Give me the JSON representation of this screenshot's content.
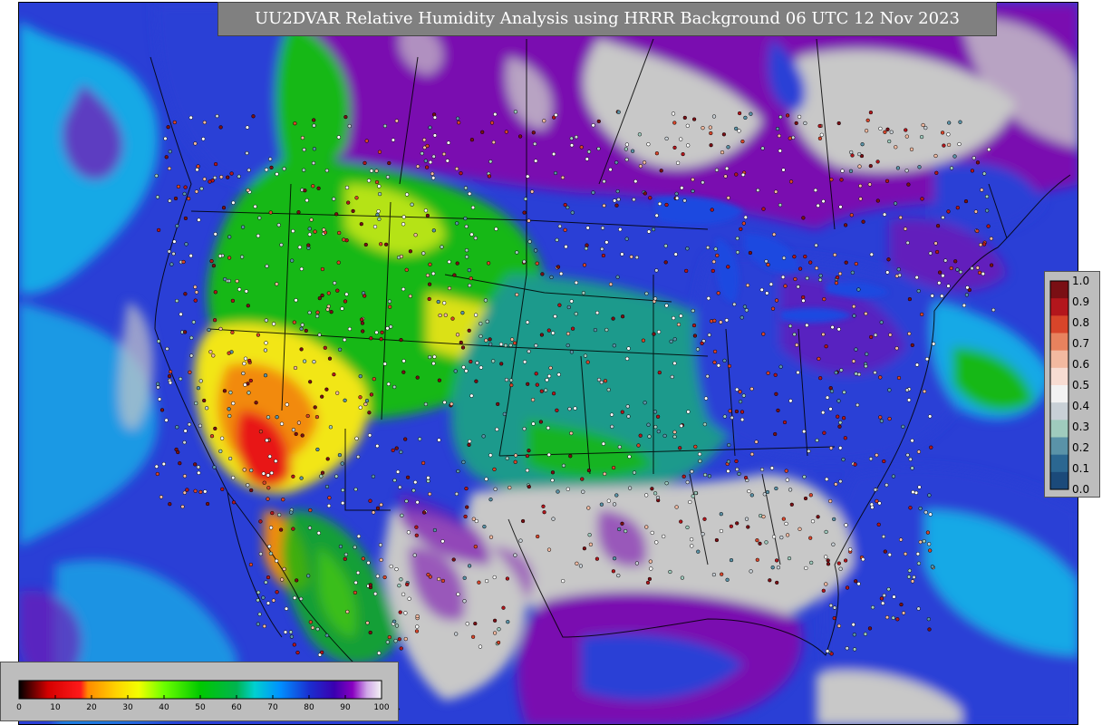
{
  "title": "UU2DVAR Relative Humidity Analysis using HRRR Background 06 UTC 12 Nov 2023",
  "colors": {
    "ocean": "#2a3fd6",
    "cloud_gray": "#c8c8c8",
    "purple": "#7a0fb0",
    "cyan": "#19a9e6",
    "green": "#12b812",
    "teal": "#1f9a8c",
    "yellow": "#f2e618",
    "orange": "#f28a0c",
    "red": "#e81818",
    "coast": "#000000"
  },
  "rh_colorbar": {
    "tick_labels": [
      "0",
      "10",
      "20",
      "30",
      "40",
      "50",
      "60",
      "70",
      "80",
      "90",
      "100"
    ],
    "stops": [
      {
        "v": 0,
        "c": "#000000"
      },
      {
        "v": 4,
        "c": "#6b0000"
      },
      {
        "v": 8,
        "c": "#d40000"
      },
      {
        "v": 17,
        "c": "#ff1a1a"
      },
      {
        "v": 19,
        "c": "#ff8a00"
      },
      {
        "v": 27,
        "c": "#ffd400"
      },
      {
        "v": 33,
        "c": "#f2ff00"
      },
      {
        "v": 40,
        "c": "#6cff00"
      },
      {
        "v": 50,
        "c": "#00c800"
      },
      {
        "v": 60,
        "c": "#00b450"
      },
      {
        "v": 65,
        "c": "#00d0d0"
      },
      {
        "v": 72,
        "c": "#0090ff"
      },
      {
        "v": 80,
        "c": "#1a2fd0"
      },
      {
        "v": 87,
        "c": "#3a00b0"
      },
      {
        "v": 92,
        "c": "#8800c0"
      },
      {
        "v": 96,
        "c": "#d0a8e8"
      },
      {
        "v": 100,
        "c": "#f4f4f4"
      }
    ]
  },
  "obs_colorbar": {
    "tick_labels": [
      "1.0",
      "0.9",
      "0.8",
      "0.7",
      "0.6",
      "0.5",
      "0.4",
      "0.3",
      "0.2",
      "0.1",
      "0.0"
    ],
    "swatches": [
      "#7a0f14",
      "#b3161c",
      "#d8452a",
      "#e8825e",
      "#f2b9a0",
      "#f7dcd2",
      "#f2f2f2",
      "#c8d0d6",
      "#9fcbbd",
      "#5a93a8",
      "#2b6791",
      "#1b4a7a"
    ]
  }
}
